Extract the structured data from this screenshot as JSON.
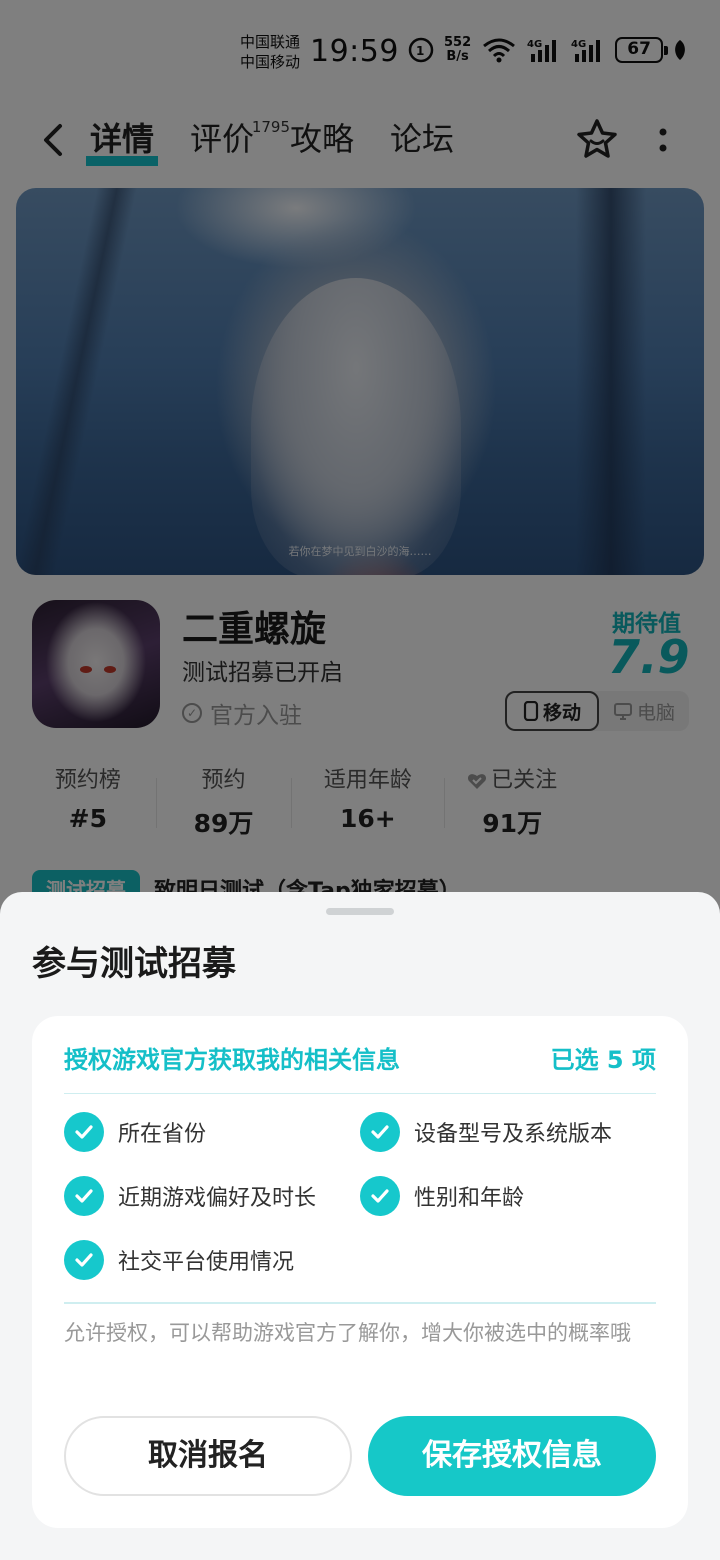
{
  "status_bar": {
    "carrier1": "中国联通",
    "carrier2": "中国移动",
    "time": "19:59",
    "net_speed_value": "552",
    "net_speed_unit": "B/s",
    "battery": "67"
  },
  "header": {
    "tabs": [
      {
        "label": "详情",
        "active": true
      },
      {
        "label": "评价",
        "badge": "1795"
      },
      {
        "label": "攻略"
      },
      {
        "label": "论坛"
      }
    ]
  },
  "banner": {
    "subtitle": "若你在梦中见到白沙的海……"
  },
  "game": {
    "name": "二重螺旋",
    "status": "测试招募已开启",
    "official": "官方入驻",
    "expect_label": "期待值",
    "expect_value": "7.9",
    "platforms": [
      "移动",
      "电脑"
    ]
  },
  "stats": [
    {
      "label": "预约榜",
      "value": "#5"
    },
    {
      "label": "预约",
      "value": "89万"
    },
    {
      "label": "适用年龄",
      "value": "16+"
    },
    {
      "label": "已关注",
      "value": "91万"
    }
  ],
  "recruit": {
    "tag": "测试招募",
    "text": "致明日测试（含Tap独家招募）"
  },
  "sheet": {
    "title": "参与测试招募",
    "card_title": "授权游戏官方获取我的相关信息",
    "selected": "已选 5 项",
    "items": [
      "所在省份",
      "设备型号及系统版本",
      "近期游戏偏好及时长",
      "性别和年龄",
      "社交平台使用情况"
    ],
    "note": "允许授权，可以帮助游戏官方了解你，增大你被选中的概率哦",
    "cancel_label": "取消报名",
    "save_label": "保存授权信息"
  },
  "colors": {
    "accent": "#16c8c8",
    "accent_text": "#15bfc8"
  }
}
